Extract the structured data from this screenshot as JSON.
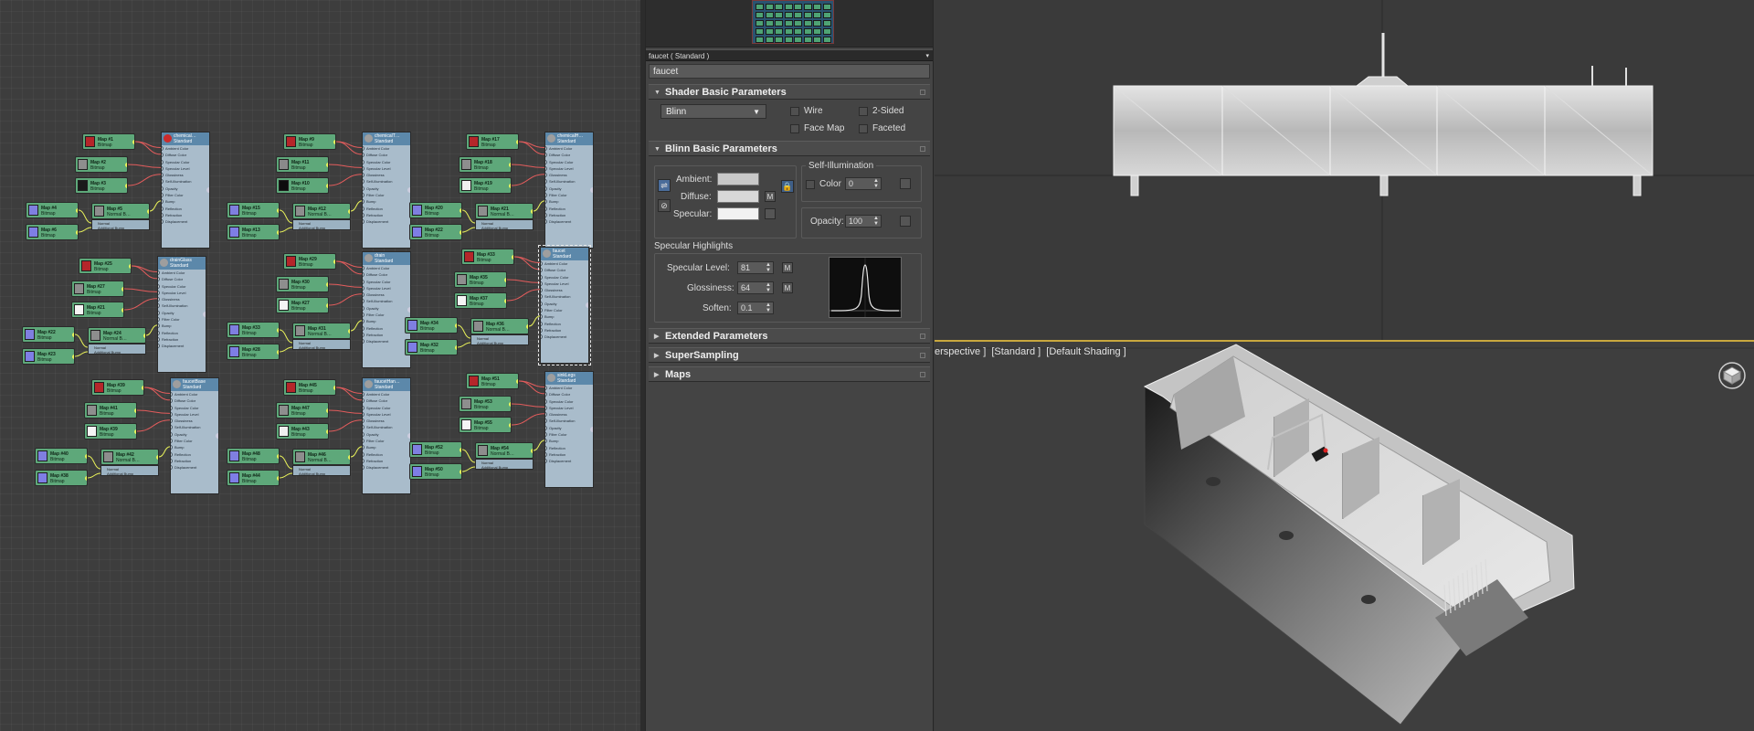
{
  "node_editor": {
    "groups": [
      {
        "material_name": "chemical…",
        "material_type": "Standard",
        "ball_color": "#cc2b2b",
        "maps": [
          "Map #1",
          "Map #2",
          "Map #3",
          "Map #4",
          "Map #5",
          "Map #6"
        ]
      },
      {
        "material_name": "chemicalT…",
        "material_type": "Standard",
        "ball_color": "#9e9e9e",
        "maps": [
          "Map #9",
          "Map #11",
          "Map #10",
          "Map #15",
          "Map #12",
          "Map #13"
        ]
      },
      {
        "material_name": "chemicalH…",
        "material_type": "Standard",
        "ball_color": "#9e9e9e",
        "maps": [
          "Map #17",
          "Map #18",
          "Map #19",
          "Map #20",
          "Map #21",
          "Map #22"
        ]
      },
      {
        "material_name": "drainGlass",
        "material_type": "Standard",
        "ball_color": "#9e9e9e",
        "maps": [
          "Map #25",
          "Map #27",
          "Map #21",
          "Map #22",
          "Map #24",
          "Map #23"
        ]
      },
      {
        "material_name": "drain",
        "material_type": "Standard",
        "ball_color": "#9e9e9e",
        "maps": [
          "Map #29",
          "Map #30",
          "Map #27",
          "Map #33",
          "Map #31",
          "Map #28"
        ]
      },
      {
        "material_name": "faucet",
        "material_type": "Standard",
        "ball_color": "#9e9e9e",
        "maps": [
          "Map #33",
          "Map #35",
          "Map #37",
          "Map #34",
          "Map #36",
          "Map #32"
        ]
      },
      {
        "material_name": "faucetBase",
        "material_type": "Standard",
        "ball_color": "#9e9e9e",
        "maps": [
          "Map #39",
          "Map #41",
          "Map #39",
          "Map #40",
          "Map #42",
          "Map #38"
        ]
      },
      {
        "material_name": "faucetHan…",
        "material_type": "Standard",
        "ball_color": "#9e9e9e",
        "maps": [
          "Map #45",
          "Map #47",
          "Map #43",
          "Map #48",
          "Map #46",
          "Map #44"
        ]
      },
      {
        "material_name": "sinkLegs",
        "material_type": "Standard",
        "ball_color": "#9e9e9e",
        "maps": [
          "Map #51",
          "Map #53",
          "Map #55",
          "Map #52",
          "Map #54",
          "Map #50"
        ]
      }
    ],
    "map_subtitle": "Bitmap",
    "normal_subtitle": "Normal B…",
    "normal_inputs": [
      "Normal",
      "Additional Bump"
    ],
    "material_slots": [
      "Ambient Color",
      "Diffuse Color",
      "Specular Color",
      "Specular Level",
      "Glossiness",
      "Self-Illumination",
      "Opacity",
      "Filter Color",
      "Bump",
      "Reflection",
      "Refraction",
      "Displacement"
    ]
  },
  "material_editor": {
    "title_bar": "faucet  ( Standard )",
    "material_name": "faucet",
    "rollouts": {
      "shader_basic": "Shader Basic Parameters",
      "blinn_basic": "Blinn Basic Parameters",
      "extended": "Extended Parameters",
      "supersampling": "SuperSampling",
      "maps": "Maps"
    },
    "shader": {
      "selected": "Blinn",
      "wire": "Wire",
      "two_sided": "2-Sided",
      "face_map": "Face Map",
      "faceted": "Faceted"
    },
    "blinn": {
      "ambient_label": "Ambient:",
      "diffuse_label": "Diffuse:",
      "specular_label": "Specular:",
      "map_button": "M",
      "self_illum_title": "Self-Illumination",
      "color_label": "Color",
      "self_illum_value": "0",
      "opacity_label": "Opacity:",
      "opacity_value": "100",
      "specular_highlights_title": "Specular Highlights",
      "specular_level_label": "Specular Level:",
      "specular_level_value": "81",
      "glossiness_label": "Glossiness:",
      "glossiness_value": "64",
      "soften_label": "Soften:",
      "soften_value": "0.1"
    },
    "colors": {
      "ambient": "#c8c8c8",
      "diffuse": "#d8d8d8",
      "specular": "#f2f2f2"
    }
  },
  "viewport": {
    "perspective_label": "erspective ]  [Standard ]  [Default Shading ]"
  }
}
